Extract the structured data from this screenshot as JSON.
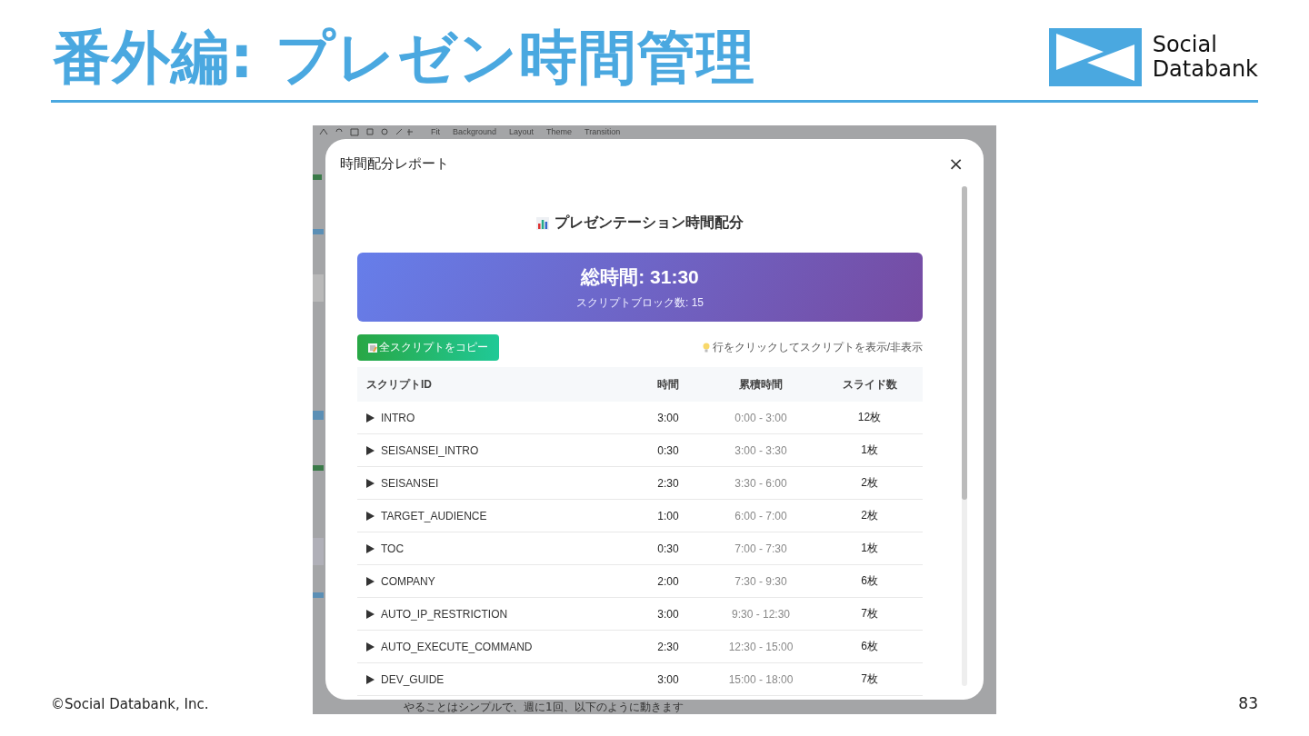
{
  "slide": {
    "title": "番外編: プレゼン時間管理",
    "logo_text": [
      "Social",
      "Databank"
    ],
    "footer": "©Social Databank, Inc.",
    "page_number": "83"
  },
  "background_app": {
    "toolbar": [
      "Fit",
      "Background",
      "Layout",
      "Theme",
      "Transition"
    ],
    "bottom_text": "やることはシンプルで、週に1回、以下のように動きます"
  },
  "dialog": {
    "title": "時間配分レポート",
    "close": "×",
    "heading": "プレゼンテーション時間配分",
    "summary": {
      "total": "総時間: 31:30",
      "blocks": "スクリプトブロック数: 15"
    },
    "copy_button": "全スクリプトをコピー",
    "hint": "行をクリックしてスクリプトを表示/非表示",
    "table": {
      "columns": [
        "スクリプトID",
        "時間",
        "累積時間",
        "スライド数"
      ],
      "rows": [
        {
          "id": "INTRO",
          "time": "3:00",
          "range": "0:00 - 3:00",
          "slides": "12枚",
          "expanded": false
        },
        {
          "id": "SEISANSEI_INTRO",
          "time": "0:30",
          "range": "3:00 - 3:30",
          "slides": "1枚",
          "expanded": false
        },
        {
          "id": "SEISANSEI",
          "time": "2:30",
          "range": "3:30 - 6:00",
          "slides": "2枚",
          "expanded": false
        },
        {
          "id": "TARGET_AUDIENCE",
          "time": "1:00",
          "range": "6:00 - 7:00",
          "slides": "2枚",
          "expanded": false
        },
        {
          "id": "TOC",
          "time": "0:30",
          "range": "7:00 - 7:30",
          "slides": "1枚",
          "expanded": false
        },
        {
          "id": "COMPANY",
          "time": "2:00",
          "range": "7:30 - 9:30",
          "slides": "6枚",
          "expanded": false
        },
        {
          "id": "AUTO_IP_RESTRICTION",
          "time": "3:00",
          "range": "9:30 - 12:30",
          "slides": "7枚",
          "expanded": false
        },
        {
          "id": "AUTO_EXECUTE_COMMAND",
          "time": "2:30",
          "range": "12:30 - 15:00",
          "slides": "6枚",
          "expanded": false
        },
        {
          "id": "DEV_GUIDE",
          "time": "3:00",
          "range": "15:00 - 18:00",
          "slides": "7枚",
          "expanded": false
        }
      ]
    }
  }
}
